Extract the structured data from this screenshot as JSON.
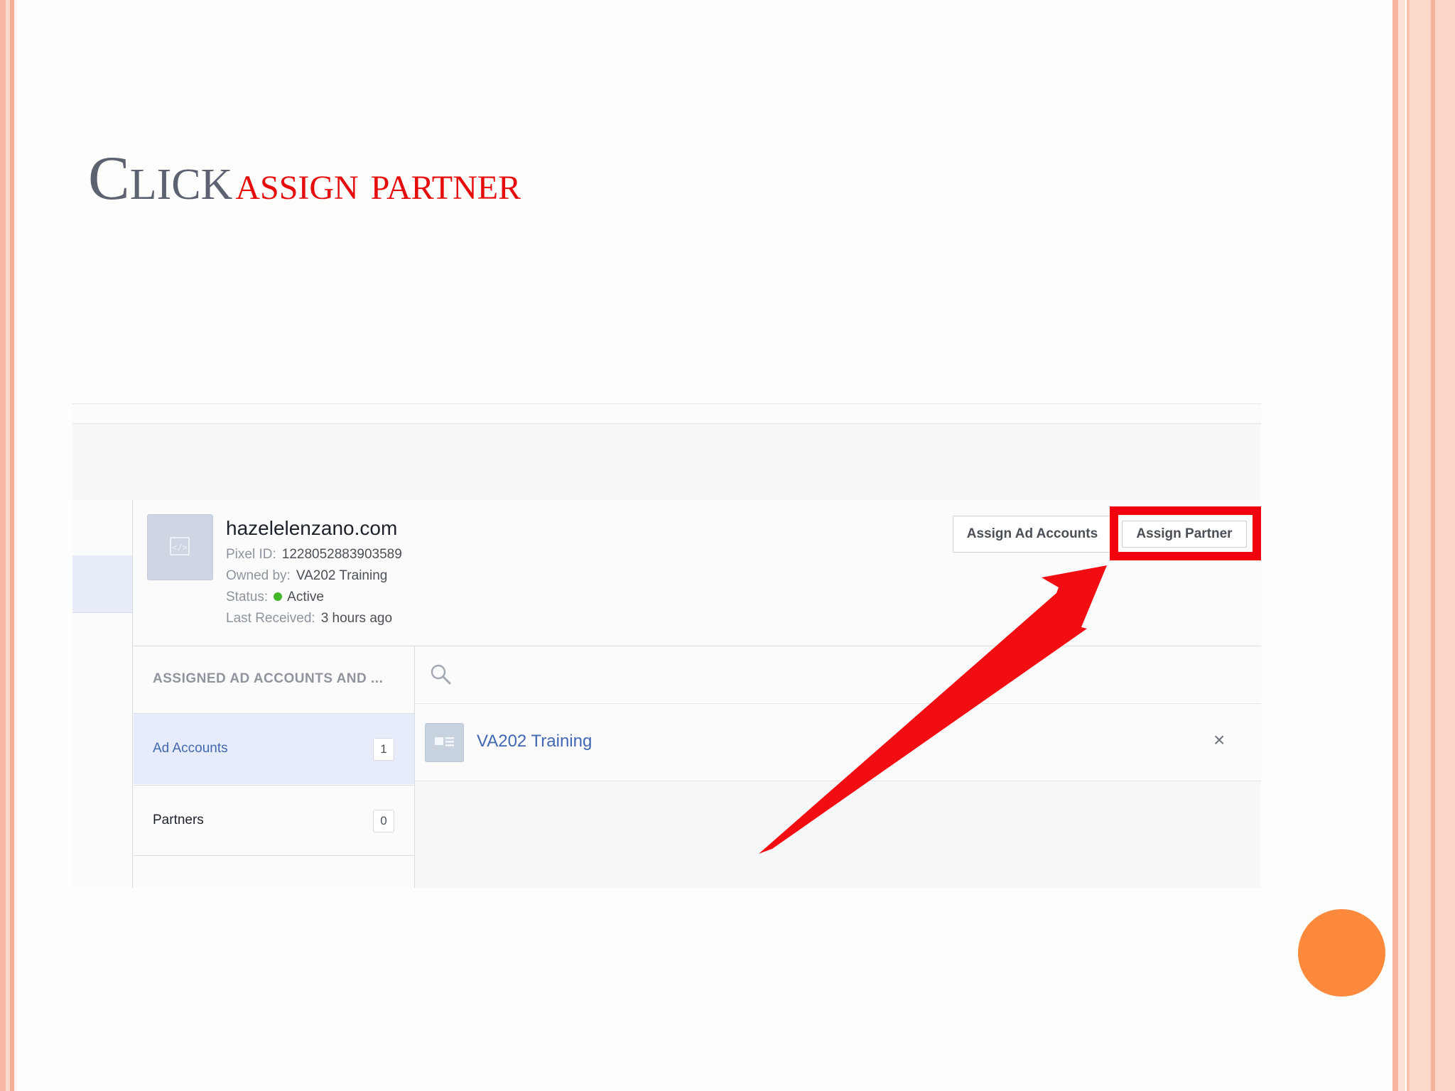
{
  "slide": {
    "title_part1": "Click",
    "title_part2": "assign partner",
    "accent_color": "#e60c0c",
    "title_color": "#5c6270"
  },
  "pixel": {
    "name": "hazelelenzano.com",
    "pixel_id_label": "Pixel ID:",
    "pixel_id": "1228052883903589",
    "owned_by_label": "Owned by:",
    "owned_by": "VA202 Training",
    "status_label": "Status:",
    "status": "Active",
    "status_color": "#42b72a",
    "last_received_label": "Last Received:",
    "last_received": "3 hours ago"
  },
  "actions": {
    "assign_ad_accounts": "Assign Ad Accounts",
    "assign_partner": "Assign Partner",
    "highlight_color": "#f0010d"
  },
  "side_panel": {
    "header": "ASSIGNED AD ACCOUNTS AND ...",
    "items": [
      {
        "label": "Ad Accounts",
        "count": "1",
        "selected": true
      },
      {
        "label": "Partners",
        "count": "0",
        "selected": false
      }
    ]
  },
  "main": {
    "search_icon": "search-icon",
    "accounts": [
      {
        "name": "VA202 Training",
        "icon": "ad-account-icon",
        "remove_icon": "close-icon"
      }
    ],
    "remove_glyph": "×"
  }
}
